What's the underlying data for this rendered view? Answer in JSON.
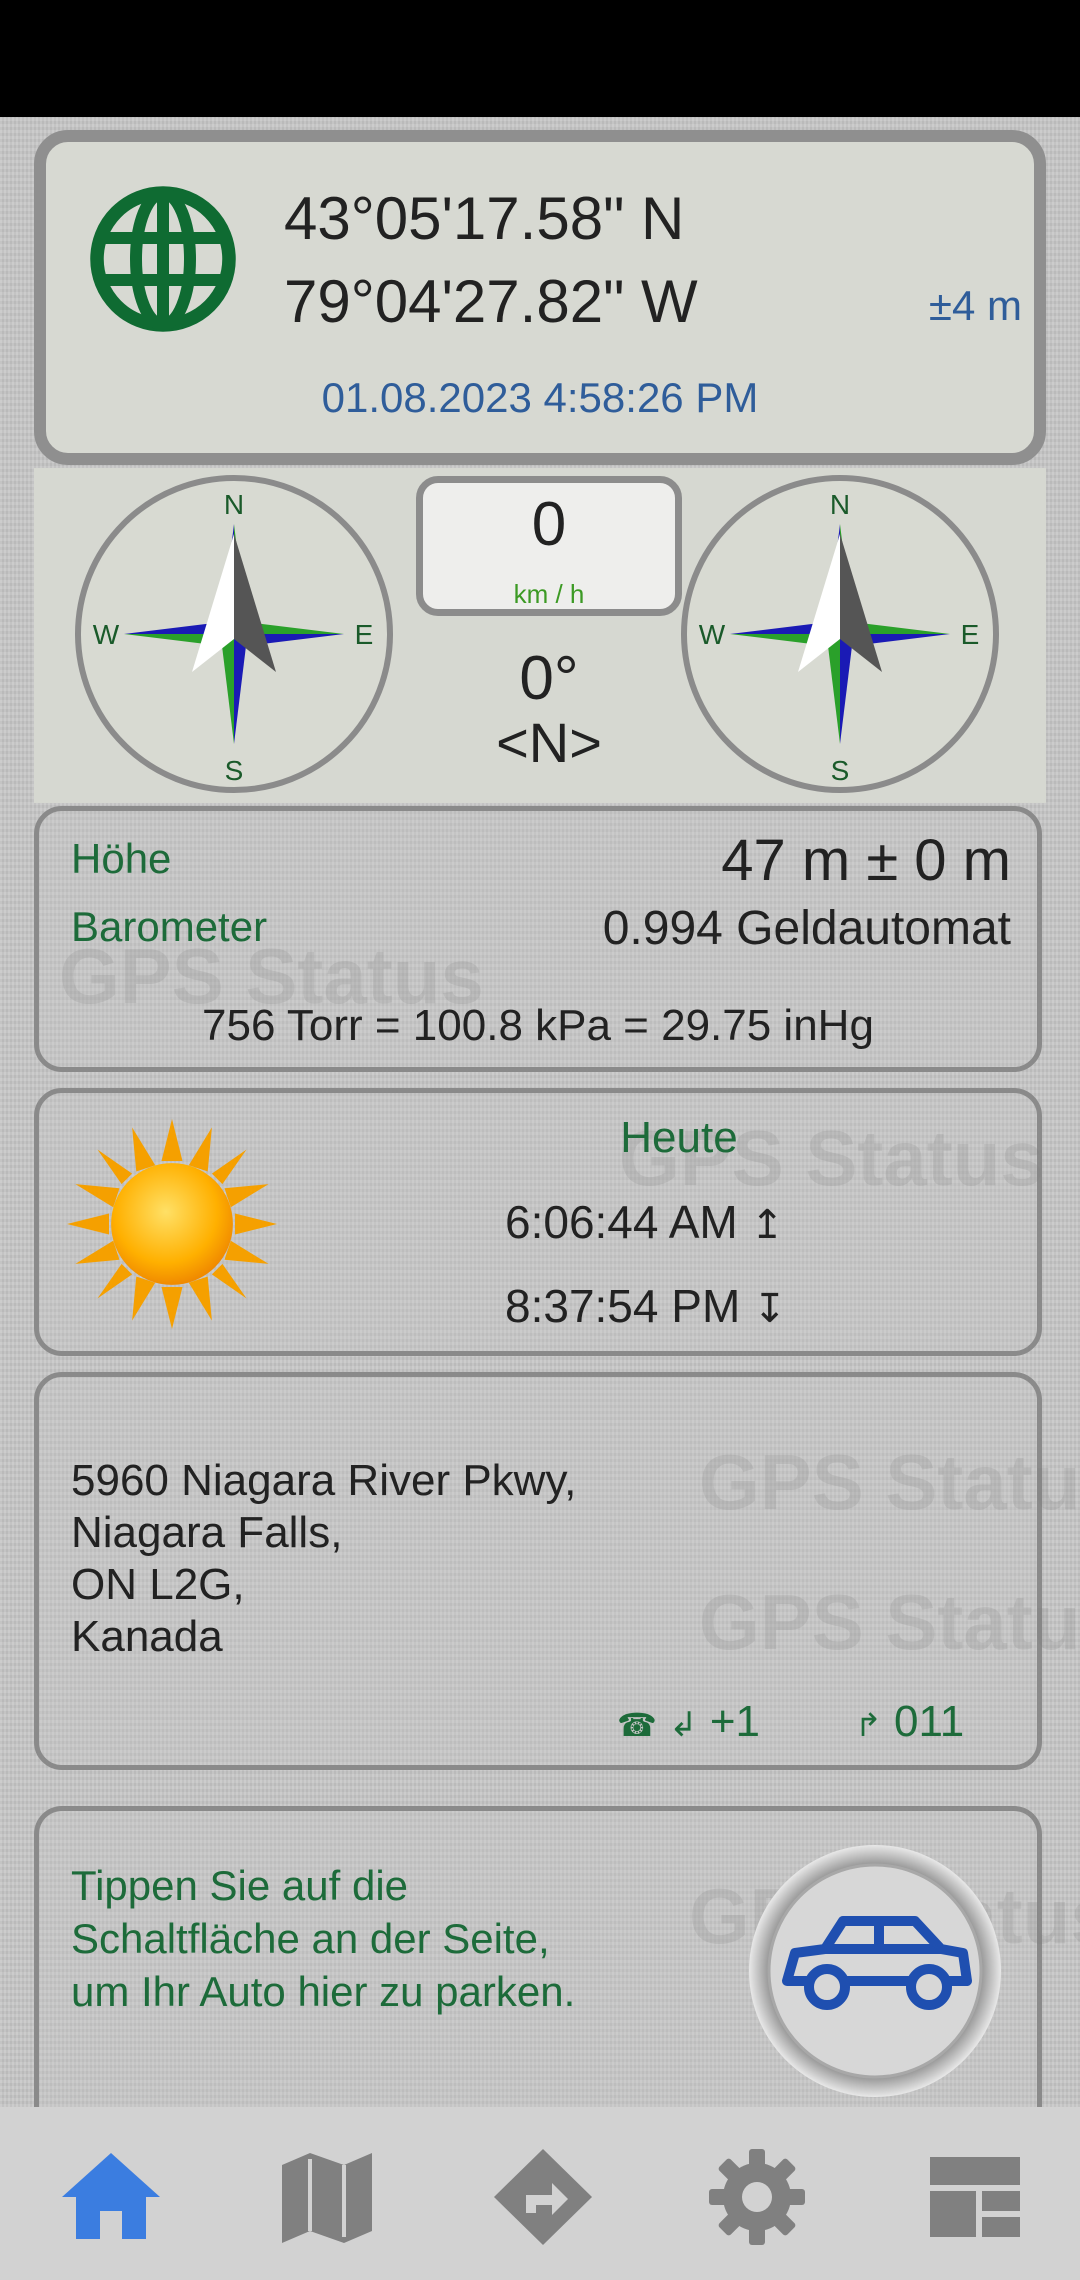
{
  "location": {
    "latitude": "43°05'17.58\" N",
    "longitude": "79°04'27.82\" W",
    "accuracy": "±4 m",
    "datetime": "01.08.2023 4:58:26 PM",
    "icon": "globe-icon"
  },
  "compass": {
    "speed_value": "0",
    "speed_unit": "km / h",
    "heading_degrees": "0°",
    "heading_direction": "<N>",
    "directions": {
      "n": "N",
      "e": "E",
      "s": "S",
      "w": "W"
    }
  },
  "altitude": {
    "height_label": "Höhe",
    "height_value": "47 m ± 0 m",
    "barometer_label": "Barometer",
    "barometer_value": "0.994 Geldautomat",
    "pressure_line": "756 Torr = 100.8 kPa = 29.75 inHg"
  },
  "sun": {
    "day_label": "Heute",
    "sunrise": "6:06:44 AM",
    "sunrise_symbol": "↥",
    "sunset": "8:37:54 PM",
    "sunset_symbol": "↧",
    "icon": "sun-icon"
  },
  "address": {
    "line1": "5960 Niagara River Pkwy,",
    "line2": "Niagara Falls,",
    "line3": "ON L2G,",
    "line4": "Kanada",
    "phone_symbol": "☎",
    "in_symbol": "↲",
    "phone_prefix": "+1",
    "out_symbol": "↱",
    "exit_code": "011"
  },
  "parking": {
    "text_line1": "Tippen Sie auf die",
    "text_line2": "Schaltfläche an der Seite,",
    "text_line3": "um Ihr Auto hier zu parken.",
    "icon": "car-icon"
  },
  "watermark": "GPS Status",
  "navbar": {
    "items": [
      "home-icon",
      "map-icon",
      "directions-icon",
      "settings-icon",
      "dashboard-icon"
    ],
    "active_color": "#3b7de0",
    "inactive_color": "#808080"
  }
}
